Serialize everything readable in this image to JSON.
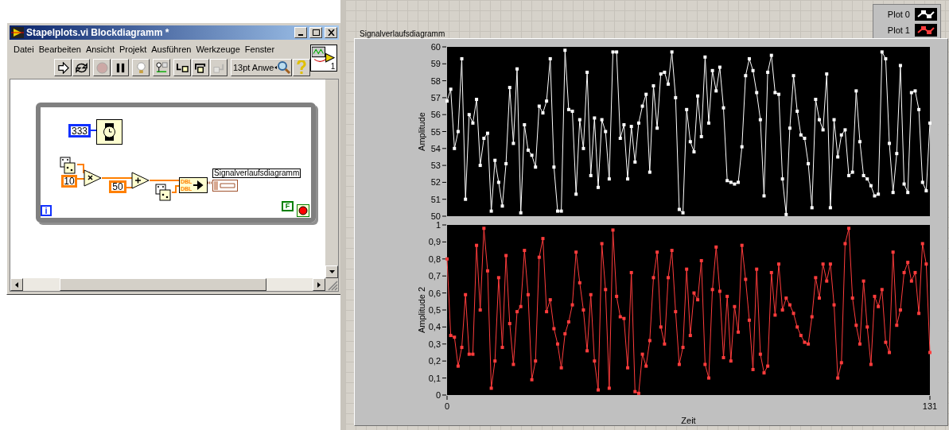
{
  "block_diagram_window": {
    "title": "Stapelplots.vi Blockdiagramm *",
    "menu": [
      "Datei",
      "Bearbeiten",
      "Ansicht",
      "Projekt",
      "Ausführen",
      "Werkzeuge",
      "Fenster"
    ],
    "toolbar": {
      "font_selector": "13pt Anwe",
      "buttons": [
        {
          "kind": "run",
          "disabled": false
        },
        {
          "kind": "run-continuous",
          "disabled": false
        },
        {
          "kind": "abort",
          "disabled": true
        },
        {
          "kind": "pause",
          "disabled": false
        },
        {
          "kind": "highlight",
          "disabled": false
        },
        {
          "kind": "retain",
          "disabled": false
        },
        {
          "kind": "step-into",
          "disabled": false
        },
        {
          "kind": "step-over",
          "disabled": false
        },
        {
          "kind": "step-out",
          "disabled": true
        }
      ]
    },
    "connector_pane_number": "1",
    "diagram": {
      "wait_constant": "333",
      "multiply_constant": "10",
      "add_constant": "50",
      "type_labels": [
        "DBL",
        "DBL"
      ],
      "graph_terminal_label": "Signalverlaufsdiagramm",
      "loop_iteration": "i",
      "stop_constant": "F"
    }
  },
  "front_panel": {
    "graph": {
      "label": "Signalverlaufsdiagramm",
      "charts": [
        {
          "chart_data": {
            "type": "line",
            "ylabel": "Amplitude",
            "x": [
              0,
              1,
              2,
              3,
              4,
              5,
              6,
              7,
              8,
              9,
              10,
              11,
              12,
              13,
              14,
              15,
              16,
              17,
              18,
              19,
              20,
              21,
              22,
              23,
              24,
              25,
              26,
              27,
              28,
              29,
              30,
              31,
              32,
              33,
              34,
              35,
              36,
              37,
              38,
              39,
              40,
              41,
              42,
              43,
              44,
              45,
              46,
              47,
              48,
              49,
              50,
              51,
              52,
              53,
              54,
              55,
              56,
              57,
              58,
              59,
              60,
              61,
              62,
              63,
              64,
              65,
              66,
              67,
              68,
              69,
              70,
              71,
              72,
              73,
              74,
              75,
              76,
              77,
              78,
              79,
              80,
              81,
              82,
              83,
              84,
              85,
              86,
              87,
              88,
              89,
              90,
              91,
              92,
              93,
              94,
              95,
              96,
              97,
              98,
              99,
              100,
              101,
              102,
              103,
              104,
              105,
              106,
              107,
              108,
              109,
              110,
              111,
              112,
              113,
              114,
              115,
              116,
              117,
              118,
              119,
              120,
              121,
              122,
              123,
              124,
              125,
              126,
              127,
              128,
              129,
              130,
              131
            ],
            "xlim": [
              0,
              131
            ],
            "ylim": [
              50,
              60
            ],
            "yticks": [
              50,
              51,
              52,
              53,
              54,
              55,
              56,
              57,
              58,
              59,
              60
            ],
            "series": [
              {
                "name": "Plot 0",
                "color": "#ffffff",
                "marker": "square",
                "values": [
                  56.8,
                  57.5,
                  54,
                  55,
                  59.3,
                  51,
                  56,
                  55.5,
                  56.9,
                  53,
                  54.6,
                  54.9,
                  50.3,
                  53.3,
                  52,
                  50.6,
                  53.1,
                  57.6,
                  54.3,
                  58.7,
                  50.2,
                  55.4,
                  53.9,
                  53.6,
                  52.9,
                  56.5,
                  56.1,
                  56.8,
                  59.3,
                  52.9,
                  50.3,
                  50.3,
                  59.8,
                  56.3,
                  56.2,
                  51.3,
                  55.7,
                  54,
                  58.5,
                  52.4,
                  55.8,
                  51.7,
                  55.7,
                  55,
                  52.2,
                  59.7,
                  59.7,
                  54.6,
                  55.4,
                  52.2,
                  55.3,
                  53.2,
                  55.5,
                  56.5,
                  57.2,
                  52.6,
                  57.7,
                  55.2,
                  58.4,
                  58.5,
                  57.8,
                  59.7,
                  57,
                  50.4,
                  50.2,
                  56.3,
                  54.4,
                  53.8,
                  57.1,
                  54.7,
                  59.4,
                  55.5,
                  58.6,
                  57.4,
                  58.8,
                  56.4,
                  52.1,
                  52,
                  51.9,
                  52,
                  54.1,
                  58.3,
                  59.3,
                  58.6,
                  57.3,
                  55.7,
                  51.2,
                  58.5,
                  59.5,
                  57.3,
                  57.2,
                  52.2,
                  50.1,
                  55.2,
                  58.3,
                  56.2,
                  54.8,
                  54.6,
                  53.1,
                  50.5,
                  56.9,
                  55.7,
                  55.1,
                  58.4,
                  50.5,
                  55.7,
                  53.5,
                  54.8,
                  55.1,
                  52.4,
                  52.6,
                  57.4,
                  54.4,
                  52.4,
                  52.2,
                  51.8,
                  51.2,
                  51.3,
                  59.7,
                  59.3,
                  54.3,
                  51.4,
                  53.7,
                  58.9,
                  51.9,
                  51.4,
                  57.3,
                  57.4,
                  56.3,
                  52,
                  51.5,
                  55.5
                ]
              }
            ]
          }
        },
        {
          "chart_data": {
            "type": "line",
            "xlabel": "Zeit",
            "ylabel": "Amplitude 2",
            "x": [
              0,
              1,
              2,
              3,
              4,
              5,
              6,
              7,
              8,
              9,
              10,
              11,
              12,
              13,
              14,
              15,
              16,
              17,
              18,
              19,
              20,
              21,
              22,
              23,
              24,
              25,
              26,
              27,
              28,
              29,
              30,
              31,
              32,
              33,
              34,
              35,
              36,
              37,
              38,
              39,
              40,
              41,
              42,
              43,
              44,
              45,
              46,
              47,
              48,
              49,
              50,
              51,
              52,
              53,
              54,
              55,
              56,
              57,
              58,
              59,
              60,
              61,
              62,
              63,
              64,
              65,
              66,
              67,
              68,
              69,
              70,
              71,
              72,
              73,
              74,
              75,
              76,
              77,
              78,
              79,
              80,
              81,
              82,
              83,
              84,
              85,
              86,
              87,
              88,
              89,
              90,
              91,
              92,
              93,
              94,
              95,
              96,
              97,
              98,
              99,
              100,
              101,
              102,
              103,
              104,
              105,
              106,
              107,
              108,
              109,
              110,
              111,
              112,
              113,
              114,
              115,
              116,
              117,
              118,
              119,
              120,
              121,
              122,
              123,
              124,
              125,
              126,
              127,
              128,
              129,
              130,
              131
            ],
            "xlim": [
              0,
              131
            ],
            "xticks": [
              0,
              131
            ],
            "ylim": [
              0,
              1
            ],
            "yticks": [
              {
                "value": 0,
                "label": "0"
              },
              {
                "value": 0.1,
                "label": "0,1"
              },
              {
                "value": 0.2,
                "label": "0,2"
              },
              {
                "value": 0.3,
                "label": "0,3"
              },
              {
                "value": 0.4,
                "label": "0,4"
              },
              {
                "value": 0.5,
                "label": "0,5"
              },
              {
                "value": 0.6,
                "label": "0,6"
              },
              {
                "value": 0.7,
                "label": "0,7"
              },
              {
                "value": 0.8,
                "label": "0,8"
              },
              {
                "value": 0.9,
                "label": "0,9"
              },
              {
                "value": 1,
                "label": "1"
              }
            ],
            "series": [
              {
                "name": "Plot 1",
                "color": "#ff3c3c",
                "marker": "square",
                "values": [
                  0.8,
                  0.35,
                  0.34,
                  0.17,
                  0.28,
                  0.59,
                  0.24,
                  0.24,
                  0.88,
                  0.5,
                  0.98,
                  0.73,
                  0.04,
                  0.2,
                  0.69,
                  0.28,
                  0.82,
                  0.42,
                  0.18,
                  0.49,
                  0.52,
                  0.85,
                  0.59,
                  0.09,
                  0.2,
                  0.81,
                  0.92,
                  0.49,
                  0.56,
                  0.39,
                  0.3,
                  0.16,
                  0.36,
                  0.43,
                  0.53,
                  0.84,
                  0.66,
                  0.5,
                  0.26,
                  0.59,
                  0.2,
                  0.03,
                  0.89,
                  0.62,
                  0.04,
                  0.97,
                  0.58,
                  0.46,
                  0.45,
                  0.16,
                  0.72,
                  0.02,
                  0.01,
                  0.24,
                  0.17,
                  0.32,
                  0.69,
                  0.84,
                  0.4,
                  0.3,
                  0.69,
                  0.85,
                  0.49,
                  0.18,
                  0.28,
                  0.74,
                  0.35,
                  0.6,
                  0.56,
                  0.79,
                  0.18,
                  0.1,
                  0.62,
                  0.87,
                  0.61,
                  0.22,
                  0.58,
                  0.2,
                  0.52,
                  0.37,
                  0.88,
                  0.68,
                  0.44,
                  0.15,
                  0.74,
                  0.24,
                  0.13,
                  0.17,
                  0.72,
                  0.47,
                  0.77,
                  0.5,
                  0.57,
                  0.53,
                  0.48,
                  0.4,
                  0.35,
                  0.31,
                  0.3,
                  0.46,
                  0.69,
                  0.57,
                  0.77,
                  0.67,
                  0.77,
                  0.53,
                  0.1,
                  0.19,
                  0.89,
                  0.98,
                  0.57,
                  0.41,
                  0.3,
                  0.67,
                  0.4,
                  0.18,
                  0.58,
                  0.52,
                  0.62,
                  0.31,
                  0.25,
                  0.84,
                  0.41,
                  0.5,
                  0.72,
                  0.78,
                  0.67,
                  0.72,
                  0.48,
                  0.89,
                  0.77,
                  0.25
                ]
              }
            ]
          }
        }
      ]
    }
  }
}
